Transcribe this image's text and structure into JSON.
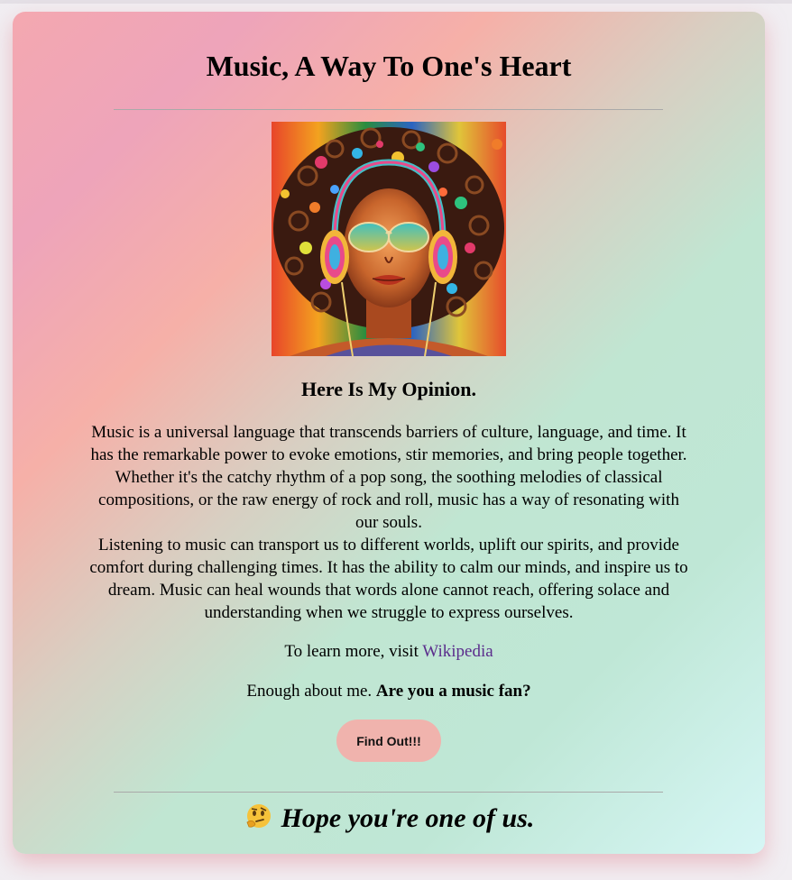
{
  "page": {
    "title": "Music, A Way To One's Heart",
    "image_alt": "Colorful painting of a woman with curly hair wearing headphones and sunglasses",
    "subtitle": "Here Is My Opinion.",
    "paragraph1": "Music is a universal language that transcends barriers of culture, language, and time. It has the remarkable power to evoke emotions, stir memories, and bring people together. Whether it's the catchy rhythm of a pop song, the soothing melodies of classical compositions, or the raw energy of rock and roll, music has a way of resonating with our souls.",
    "paragraph2": "Listening to music can transport us to different worlds, uplift our spirits, and provide comfort during challenging times. It has the ability to calm our minds, and inspire us to dream. Music can heal wounds that words alone cannot reach, offering solace and understanding when we struggle to express ourselves.",
    "learn_prefix": "To learn more, visit ",
    "learn_link": "Wikipedia",
    "fan_prefix": "Enough about me. ",
    "fan_bold": "Are you a music fan?",
    "button_label": "Find Out!!!",
    "closing": "Hope you're one of us.",
    "closing_icon": "thinking-face-icon"
  },
  "colors": {
    "link": "#5b2d8c",
    "button": "#f0b3ad",
    "rule": "#a9a9a9"
  }
}
